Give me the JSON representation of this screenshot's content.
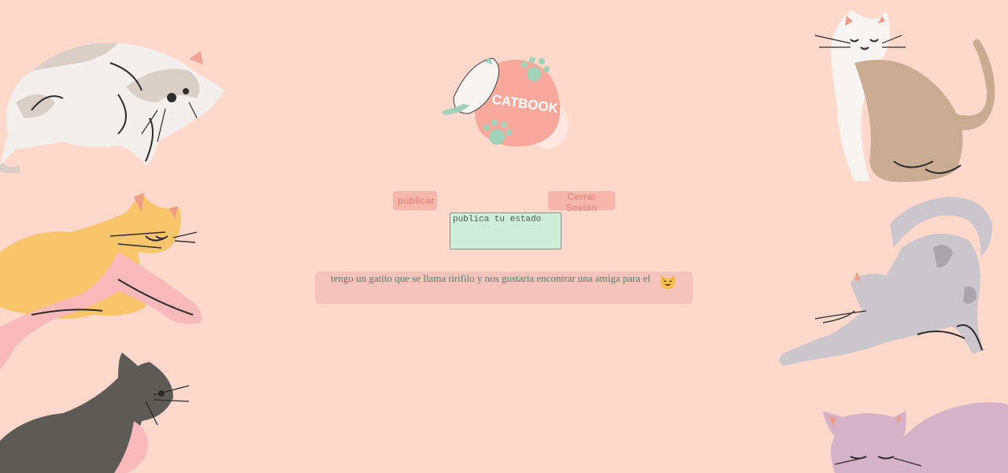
{
  "logo": {
    "text": "CATBOOK"
  },
  "actions": {
    "publish_label": "publicar",
    "logout_label": "Cerrar Sesión"
  },
  "status": {
    "placeholder": "publica tu estado",
    "value": ""
  },
  "posts": [
    {
      "text": "tengo un gatito que se llama tirifilo y nos gustaria encontrar una amiga para el",
      "emoji": "smiling-cat-emoji"
    }
  ],
  "colors": {
    "background": "#fed8cb",
    "button": "#f6b6aa",
    "button_text": "#e78e84",
    "input_bg": "#cfeeda",
    "post_bg": "#f4c3bb",
    "post_text": "#5c7a6a",
    "logo_blob": "#f7a89a",
    "paw": "#9fd2b8"
  },
  "decorations": [
    "white-gray-cat-lying",
    "orange-cat-stretching",
    "dark-gray-cat",
    "white-tan-cat-sitting",
    "gray-cat-stretching",
    "lilac-cat-sleeping"
  ]
}
